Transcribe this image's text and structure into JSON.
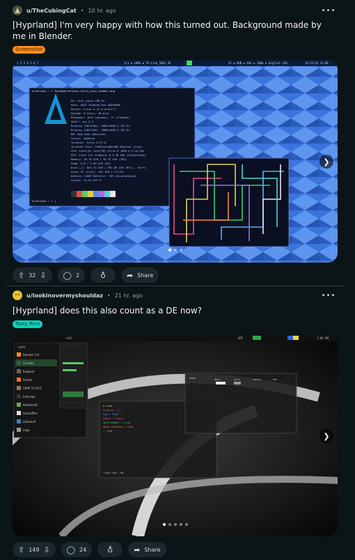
{
  "posts": [
    {
      "subreddit": "u/TheCubingCat",
      "age": "10 hr. ago",
      "title": "[Hyprland] I'm very happy with how this turned out. Background made by me in Blender.",
      "flair": "Screenshot",
      "flair_color": "#ff8c1a",
      "flair_text_color": "#3a1a00",
      "votes": "32",
      "comments": "2",
      "share_label": "Share",
      "carousel_index": 1,
      "carousel_count": 3
    },
    {
      "subreddit": "u/lookinovermyshouldaz",
      "age": "21 hr. ago",
      "title": "[Hyprland] does this also count as a DE now?",
      "flair": "Tasty Rice",
      "flair_color": "#0dd3bb",
      "flair_text_color": "#033a33",
      "votes": "149",
      "comments": "24",
      "share_label": "Share",
      "carousel_index": 1,
      "carousel_count": 5
    }
  ],
  "icons": {
    "more": "more-icon",
    "upvote": "upvote-icon",
    "downvote": "downvote-icon",
    "comment": "comment-icon",
    "award": "award-icon",
    "share": "share-icon",
    "next": "chevron-right-icon"
  },
  "screenshot1": {
    "terminal_prompt": "archlinux ~ > fajoo@archlinux:/Arch_Linux_Symbol.png",
    "info": [
      "OS: Arch Linux x86_64",
      "Host: ASUS Zenbook Duo UX8406MA",
      "Kernel: Linux 6.12.4-arch1-1",
      "Uptime: 8 hours, 48 mins",
      "Packages: 1075 (pacman), 11 (flatpak)",
      "Shell: zsh 5.9",
      "Display (SDC41A0): 2880x1800 @ 120 Hz",
      "Display (SDC41A0): 2880x1800 @ 120 Hz",
      "WM: Hyprland (Wayland)",
      "Cursor: Adwaita",
      "Terminal: kitty 0.37.0",
      "Terminal Font: JetBrainsMonoNF-Regular (11pt)",
      "CPU: Intel(R) Core(TM) Ultra 9 185H @ 5.10 GHz",
      "GPU: Intel Arc Graphics @ 2.35 GHz [Integrated]",
      "Memory: 10.76 GiB / 30.72 GiB (35%)",
      "Swap: 0 B / 4.00 GiB (0%)",
      "Disk (/): 833.72 GiB / 952.86 GiB (87%) - btrfs",
      "Local IP (wlo1): 192.168.1.177/24",
      "Battery (ASUS Battery): 56% [Discharging]",
      "Locale: en_US.UTF-8"
    ],
    "prompt2": "archlinux ~ > |"
  },
  "screenshot2": {
    "launcher_title": "rofi",
    "apps": [
      "Blender 3.6",
      "Console",
      "Explorer",
      "Firefox",
      "GIMP 3.0 RC1",
      "Inkscape",
      "KeePassXC",
      "Libreoffice",
      "Librewolf",
      "Logo"
    ],
    "term_title": "ranger - nvim style subs",
    "clock": "1:01 PM"
  }
}
